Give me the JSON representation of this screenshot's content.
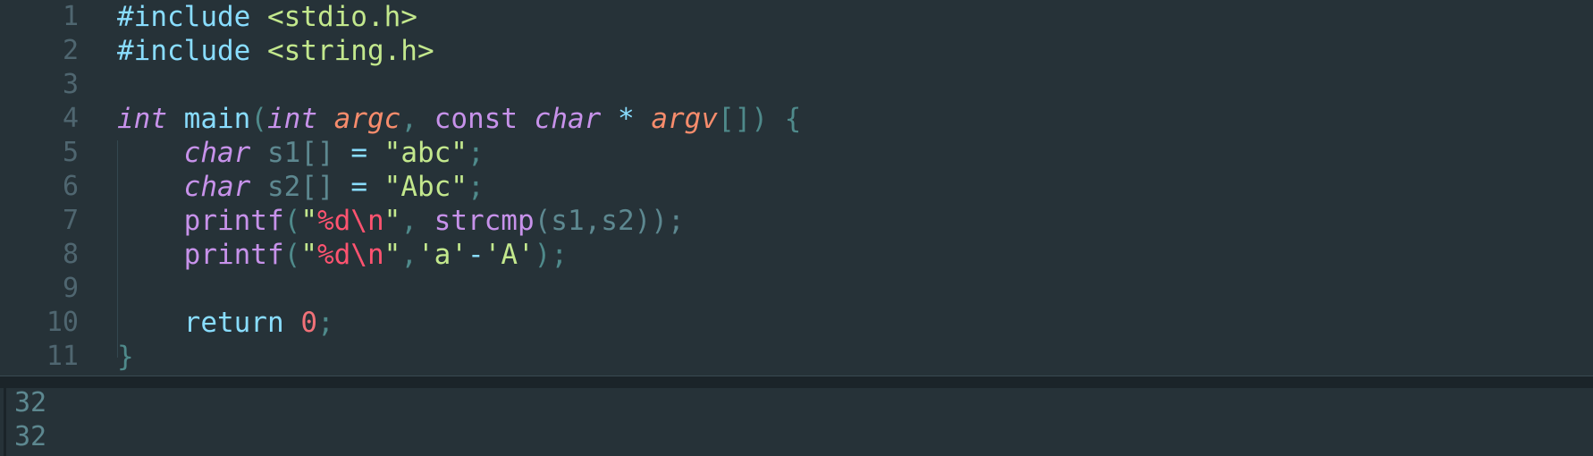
{
  "editor": {
    "line_numbers": [
      "1",
      "2",
      "3",
      "4",
      "5",
      "6",
      "7",
      "8",
      "9",
      "10",
      "11"
    ],
    "lines": {
      "l1": {
        "directive": "#include",
        "header": "<stdio.h>"
      },
      "l2": {
        "directive": "#include",
        "header": "<string.h>"
      },
      "l4": {
        "ret_type": "int",
        "fn_name": "main",
        "open_paren": "(",
        "param1_type": "int",
        "param1_name": "argc",
        "comma": ",",
        "param2_qual": "const",
        "param2_type": "char",
        "star": "*",
        "param2_name": "argv",
        "brackets_close": "[])",
        "open_brace": "{"
      },
      "l5": {
        "type": "char",
        "var": "s1[]",
        "eq": "=",
        "value": "\"abc\"",
        "semi": ";"
      },
      "l6": {
        "type": "char",
        "var": "s2[]",
        "eq": "=",
        "value": "\"Abc\"",
        "semi": ";"
      },
      "l7": {
        "fn": "printf",
        "open": "(",
        "q1": "\"",
        "fmt": "%d\\n",
        "q2": "\"",
        "comma": ",",
        "fn2": "strcmp",
        "args": "(s1,s2));"
      },
      "l8": {
        "fn": "printf",
        "open": "(",
        "q1": "\"",
        "fmt": "%d\\n",
        "q2": "\"",
        "comma": ",",
        "char1": "'a'",
        "minus": "-",
        "char2": "'A'",
        "close": ");"
      },
      "l10": {
        "kw": "return",
        "num": "0",
        "semi": ";"
      },
      "l11": {
        "close_brace": "}"
      }
    }
  },
  "output": {
    "lines": [
      "32",
      "32"
    ]
  },
  "colors": {
    "background": "#263238",
    "line_number": "#4f6670",
    "keyword": "#c792ea",
    "string": "#c3e88d",
    "parameter": "#f78c6c",
    "function": "#82aaff",
    "number": "#f07178"
  }
}
